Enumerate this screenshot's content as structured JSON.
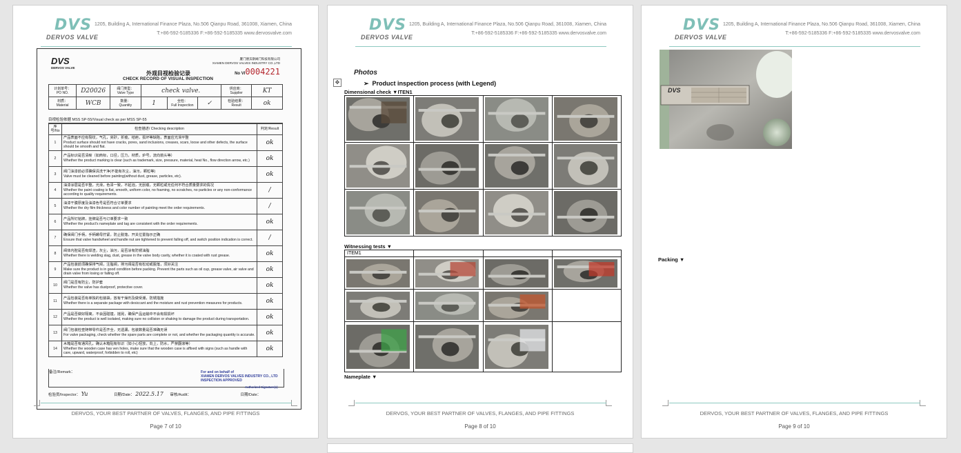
{
  "header": {
    "logo_mark": "DVS",
    "logo_name": "DERVOS VALVE",
    "address": "1205, Building A, International Finance Plaza, No.506 Qianpu Road, 361008, Xiamen, China",
    "contact": "T:+86-592-5185336   F:+86-592-5185335   www.dervosvalve.com"
  },
  "footer": {
    "tagline": "DERVOS, YOUR BEST PARTNER OF VALVES, FLANGES, AND PIPE FITTINGS"
  },
  "pages": [
    {
      "page_label": "Page 7 of 10"
    },
    {
      "page_label": "Page 8 of 10"
    },
    {
      "page_label": "Page 9 of 10"
    }
  ],
  "form": {
    "logo": "DVS",
    "logo_sub": "DERVOS VALVE",
    "company_cn": "厦门德沃斯阀门科技有限公司",
    "company_en": "XIAMEN DERVOS VALVES INDUSTRY CO.,LTD",
    "no_label": "No VI",
    "no_value": "0004221",
    "title_cn": "外观目视检验记录",
    "title_en": "CHECK RECORD OF VISUAL INSPECTION",
    "info": {
      "po_label": "计划单号：\nPO NO.",
      "po_value": "D20026",
      "valve_type_label": "阀门类型：\nValve Type",
      "valve_type_value": "check valve.",
      "supplier_label": "供应商：\nSupplier",
      "supplier_value": "KT",
      "material_label": "材质：\nMaterial",
      "material_value": "WCB",
      "quantity_label": "数量：\nQuantity",
      "quantity_value": "1",
      "full_inspection_label": "全检：\nFull Inspection",
      "full_inspection_value": "✓",
      "result_label": "检验结果：\nResult",
      "result_value": "ok"
    },
    "basis": "目视检验依据 MSS SP-55/Visual check as per  MSS SP-55",
    "columns": {
      "no": "序号/No",
      "desc": "检查描述/ Checking description",
      "result": "判定/Result"
    },
    "items": [
      {
        "no": "1",
        "cn": "产品表面不应有裂纹，气孔，夹砂，折痕，结疤，损坏等缺陷，表面应光滑平整",
        "en": "Product surface should not have cracks, pores, sand inclusions, creases, scars, loose and other defects, the surface should be smooth and flat.",
        "result": "ok"
      },
      {
        "no": "2",
        "cn": "产品标识是否清晰（如商标，口径，压力，材质，炉号，流向箭头等）",
        "en": "Whether the product marking is clear (such as trademark, size, pressure, material, heat No., flow direction arrow, etc.)",
        "result": "ok"
      },
      {
        "no": "3",
        "cn": "阀门油漆前必须确保清洗干净(不能有灰尘，油污，颗粒等)",
        "en": "Valve must be cleaned before painting(without dust, grease, particles, etc).",
        "result": "ok"
      },
      {
        "no": "4",
        "cn": "油漆涂层是否平整，光滑，色泽一致，不起泡，无刮痕，无颗粒或无任何不符合质量要求的情况",
        "en": "Whether the paint coating is flat, smooth, uniform color, no foaming, no scratches, no particles or any non-conformance according to quality requirements.",
        "result": "/"
      },
      {
        "no": "5",
        "cn": "油漆干膜厚度及油漆色号是否符合订单要求",
        "en": "Whether the dry film thickness and color number of painting meet the order requirements.",
        "result": "/"
      },
      {
        "no": "6",
        "cn": "产品所钉铭牌，挂牌是否与订单要求一致",
        "en": "Whether the product's nameplate and tag are consistent with the order requirements.",
        "result": "ok"
      },
      {
        "no": "7",
        "cn": "确保阀门手柄，手柄螺母拧紧，防止脱落，开关位置指示正确",
        "en": "Ensure that valve handwheel and handle nut are tightened to prevent falling off, and switch position indication is correct.",
        "result": "/"
      },
      {
        "no": "8",
        "cn": "阀体内腔是否有焊渣，灰尘，油污，是否涂有防锈油脂",
        "en": "Whether there is welding slag, dust, grease in the valve body cavity, whether it is coated with rust grease.",
        "result": "ok"
      },
      {
        "no": "9",
        "cn": "产品包装前须确保排气阀，注脂阀，排污阀是否有松动或脱落，须好关注",
        "en": "Make sure the product is in good condition before packing. Prevent the parts such as oil cup, grease valve, air valve and drain valve from losing or falling off.",
        "result": "ok"
      },
      {
        "no": "10",
        "cn": "阀门是否有防尘，防护套",
        "en": "Whether the valve has dustproof, protective cover.",
        "result": "ok"
      },
      {
        "no": "11",
        "cn": "产品包装是否有单独的包装袋，放有干燥剂及做受潮，防锈措施",
        "en": "Whether there is a separate package with desiccant and the moisture and rust prevention measures for products.",
        "result": "ok"
      },
      {
        "no": "12",
        "cn": "产品是否做好隔离，不会因碰撞，摇晃，确保产品运输中不会有损损坏",
        "en": "Whether the product is well isolated, making sure no collision or shaking to damage the product during transportation.",
        "result": "ok"
      },
      {
        "no": "13",
        "cn": "阀门包装检查随带零件是否齐全，无遗漏，包装数量是否准确无误",
        "en": "For valve packaging, check whether the spare parts are complete or not, and whether the packaging quantity is accurate.",
        "result": "ok"
      },
      {
        "no": "14",
        "cn": "木箱是否有通风孔，确认木箱贴有标识（如小心轻放，向上，防水，严禁翻滚等）",
        "en": "Whether the wooden case has ven holes, make sure that the wooden case is affixed with signs (such as handle with care, upward, waterproof, forbidden to roll, etc)",
        "result": "ok"
      }
    ],
    "remark_label": "备注/Remark：",
    "stamp": [
      "For and on behalf of",
      "XIAMEN DERVOS VALVES INDUSTRY CO., LTD",
      "INSPECTION  APPROVED",
      "Authorized Signature(s)"
    ],
    "inspector_label": "检验员/Inspector：",
    "inspector_value": "Yu",
    "date_label": "日期/Date：",
    "date_value": "2022.5.17",
    "audit_label": "审核/Audit：",
    "date2_label": "日期/Date："
  },
  "photos_page": {
    "heading": "Photos",
    "process_title": "Product inspection process (with Legend)",
    "dimensional_label": "Dimensional check  ▼ITEN1",
    "witnessing_label": "Witnessing tests  ▼",
    "witness_item": "ITEM1",
    "nameplate_label": "Nameplate  ▼"
  },
  "page9": {
    "packing_label": "Packing  ▼",
    "nameplate_badge": "DVS"
  }
}
